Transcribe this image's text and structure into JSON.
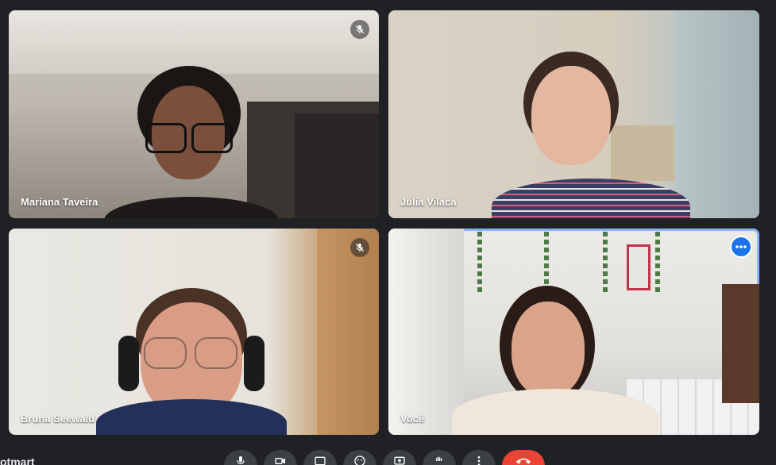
{
  "participants": [
    {
      "name": "Mariana Taveira",
      "muted": true
    },
    {
      "name": "Julia Vilaca",
      "muted": false
    },
    {
      "name": "Bruna Seewald",
      "muted": true
    },
    {
      "name": "Você",
      "muted": false,
      "is_self": true
    }
  ],
  "meeting": {
    "name_partial": "otmart"
  },
  "controls": [
    {
      "icon": "microphone-icon"
    },
    {
      "icon": "camera-icon"
    },
    {
      "icon": "captions-icon"
    },
    {
      "icon": "emoji-icon"
    },
    {
      "icon": "present-screen-icon"
    },
    {
      "icon": "raise-hand-icon"
    },
    {
      "icon": "more-options-icon"
    },
    {
      "icon": "leave-call-icon"
    }
  ],
  "colors": {
    "background": "#202124",
    "active_border": "#8ab4f8",
    "leave_button": "#ea4335",
    "more_button": "#1a73e8"
  }
}
